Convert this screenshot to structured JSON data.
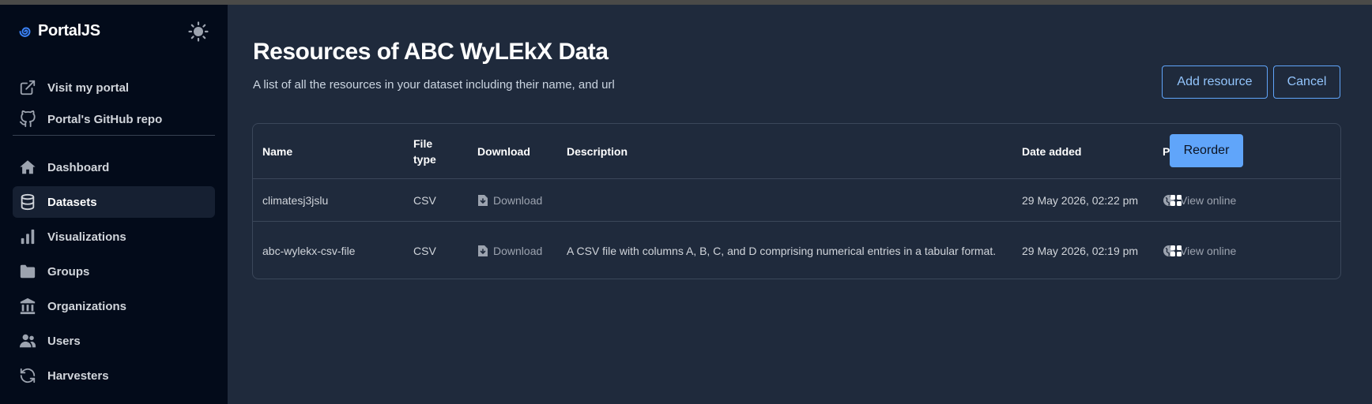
{
  "sidebar": {
    "brand": "PortalJS",
    "links_top": [
      {
        "label": "Visit my portal",
        "icon": "external-link-icon"
      },
      {
        "label": "Portal's GitHub repo",
        "icon": "github-icon"
      }
    ],
    "nav": [
      {
        "label": "Dashboard",
        "icon": "home-icon",
        "active": false
      },
      {
        "label": "Datasets",
        "icon": "database-icon",
        "active": true
      },
      {
        "label": "Visualizations",
        "icon": "bar-chart-icon",
        "active": false
      },
      {
        "label": "Groups",
        "icon": "folder-icon",
        "active": false
      },
      {
        "label": "Organizations",
        "icon": "building-icon",
        "active": false
      },
      {
        "label": "Users",
        "icon": "users-icon",
        "active": false
      },
      {
        "label": "Harvesters",
        "icon": "refresh-icon",
        "active": false
      }
    ]
  },
  "page": {
    "title": "Resources of ABC WyLEkX Data",
    "subtitle": "A list of all the resources in your dataset including their name, and url",
    "add_resource": "Add resource",
    "cancel": "Cancel",
    "reorder": "Reorder"
  },
  "table": {
    "headers": {
      "name": "Name",
      "file_type": "File type",
      "download": "Download",
      "description": "Description",
      "date_added": "Date added",
      "public_access": "Public access"
    },
    "rows": [
      {
        "name": "climatesj3jslu",
        "file_type": "CSV",
        "download": "Download",
        "description": "",
        "date_added": "29 May 2026, 02:22 pm",
        "public_access": "View online"
      },
      {
        "name": "abc-wylekx-csv-file",
        "file_type": "CSV",
        "download": "Download",
        "description": "A CSV file with columns A, B, C, and D comprising numerical entries in a tabular format.",
        "date_added": "29 May 2026, 02:19 pm",
        "public_access": "View online"
      }
    ]
  },
  "colors": {
    "accent": "#60a5fa",
    "sidebar_bg": "#030b1a",
    "main_bg": "#1f2a3c"
  }
}
